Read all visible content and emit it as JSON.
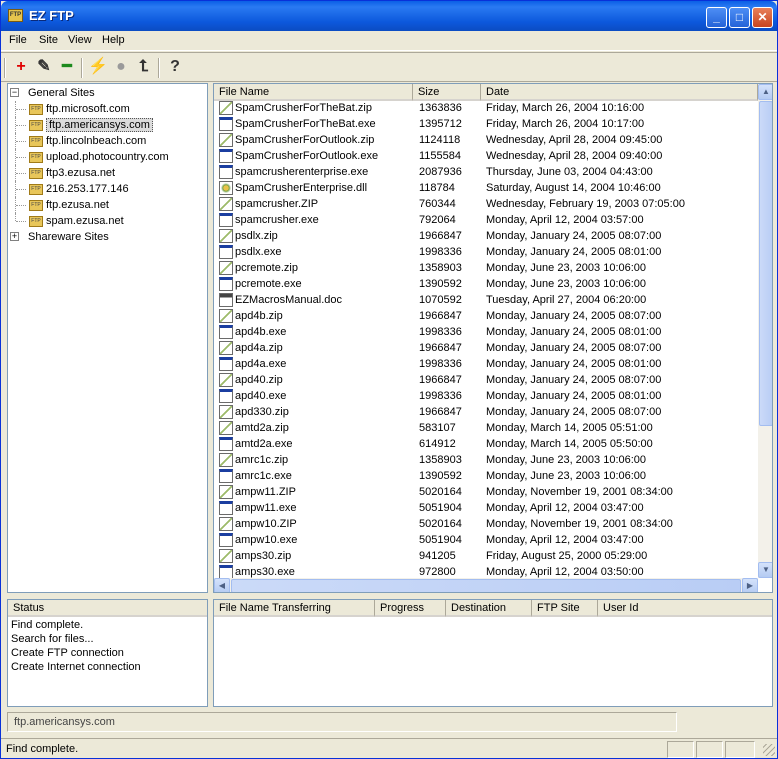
{
  "window": {
    "title": "EZ FTP",
    "app_icon_text": "FTP",
    "minimize": "_",
    "maximize": "□",
    "close": "✕"
  },
  "menu": [
    "File",
    "Site",
    "View",
    "Help"
  ],
  "toolbar": [
    {
      "name": "add-site-button",
      "glyph": "+",
      "color": "#e00000"
    },
    {
      "name": "edit-site-button",
      "glyph": "✎",
      "color": "#333333"
    },
    {
      "name": "remove-site-button",
      "glyph": "━",
      "color": "#1d8a1d"
    },
    {
      "name": "connect-button",
      "glyph": "⚡",
      "color": "#d9a400"
    },
    {
      "name": "disconnect-button",
      "glyph": "●",
      "color": "#9a9a9a"
    },
    {
      "name": "folder-up-button",
      "glyph": "⮤",
      "color": "#333333"
    },
    {
      "name": "help-button",
      "glyph": "?",
      "color": "#333333"
    }
  ],
  "tree": {
    "groups": [
      {
        "label": "General Sites",
        "expanded": true,
        "sites": [
          "ftp.microsoft.com",
          "ftp.americansys.com",
          "ftp.lincolnbeach.com",
          "upload.photocountry.com",
          "ftp3.ezusa.net",
          "216.253.177.146",
          "ftp.ezusa.net",
          "spam.ezusa.net"
        ],
        "selected": "ftp.americansys.com"
      },
      {
        "label": "Shareware Sites",
        "expanded": false,
        "sites": []
      }
    ],
    "folder_icon_text": "FTP",
    "expanded_symbol": "−",
    "collapsed_symbol": "+"
  },
  "files": {
    "columns": [
      "File Name",
      "Size",
      "Date"
    ],
    "rows": [
      {
        "name": "SpamCrusherForTheBat.zip",
        "size": "1363836",
        "date": "Friday, March 26, 2004 10:16:00",
        "type": "zip"
      },
      {
        "name": "SpamCrusherForTheBat.exe",
        "size": "1395712",
        "date": "Friday, March 26, 2004 10:17:00",
        "type": "exe"
      },
      {
        "name": "SpamCrusherForOutlook.zip",
        "size": "1124118",
        "date": "Wednesday, April 28, 2004 09:45:00",
        "type": "zip"
      },
      {
        "name": "SpamCrusherForOutlook.exe",
        "size": "1155584",
        "date": "Wednesday, April 28, 2004 09:40:00",
        "type": "exe"
      },
      {
        "name": "spamcrusherenterprise.exe",
        "size": "2087936",
        "date": "Thursday, June 03, 2004 04:43:00",
        "type": "exe"
      },
      {
        "name": "SpamCrusherEnterprise.dll",
        "size": "118784",
        "date": "Saturday, August 14, 2004 10:46:00",
        "type": "dll"
      },
      {
        "name": "spamcrusher.ZIP",
        "size": "760344",
        "date": "Wednesday, February 19, 2003 07:05:00",
        "type": "zip"
      },
      {
        "name": "spamcrusher.exe",
        "size": "792064",
        "date": "Monday, April 12, 2004 03:57:00",
        "type": "exe"
      },
      {
        "name": "psdlx.zip",
        "size": "1966847",
        "date": "Monday, January 24, 2005 08:07:00",
        "type": "zip"
      },
      {
        "name": "psdlx.exe",
        "size": "1998336",
        "date": "Monday, January 24, 2005 08:01:00",
        "type": "exe"
      },
      {
        "name": "pcremote.zip",
        "size": "1358903",
        "date": "Monday, June 23, 2003 10:06:00",
        "type": "zip"
      },
      {
        "name": "pcremote.exe",
        "size": "1390592",
        "date": "Monday, June 23, 2003 10:06:00",
        "type": "exe"
      },
      {
        "name": "EZMacrosManual.doc",
        "size": "1070592",
        "date": "Tuesday, April 27, 2004 06:20:00",
        "type": "doc"
      },
      {
        "name": "apd4b.zip",
        "size": "1966847",
        "date": "Monday, January 24, 2005 08:07:00",
        "type": "zip"
      },
      {
        "name": "apd4b.exe",
        "size": "1998336",
        "date": "Monday, January 24, 2005 08:01:00",
        "type": "exe"
      },
      {
        "name": "apd4a.zip",
        "size": "1966847",
        "date": "Monday, January 24, 2005 08:07:00",
        "type": "zip"
      },
      {
        "name": "apd4a.exe",
        "size": "1998336",
        "date": "Monday, January 24, 2005 08:01:00",
        "type": "exe"
      },
      {
        "name": "apd40.zip",
        "size": "1966847",
        "date": "Monday, January 24, 2005 08:07:00",
        "type": "zip"
      },
      {
        "name": "apd40.exe",
        "size": "1998336",
        "date": "Monday, January 24, 2005 08:01:00",
        "type": "exe"
      },
      {
        "name": "apd330.zip",
        "size": "1966847",
        "date": "Monday, January 24, 2005 08:07:00",
        "type": "zip"
      },
      {
        "name": "amtd2a.zip",
        "size": "583107",
        "date": "Monday, March 14, 2005 05:51:00",
        "type": "zip"
      },
      {
        "name": "amtd2a.exe",
        "size": "614912",
        "date": "Monday, March 14, 2005 05:50:00",
        "type": "exe"
      },
      {
        "name": "amrc1c.zip",
        "size": "1358903",
        "date": "Monday, June 23, 2003 10:06:00",
        "type": "zip"
      },
      {
        "name": "amrc1c.exe",
        "size": "1390592",
        "date": "Monday, June 23, 2003 10:06:00",
        "type": "exe"
      },
      {
        "name": "ampw11.ZIP",
        "size": "5020164",
        "date": "Monday, November 19, 2001 08:34:00",
        "type": "zip"
      },
      {
        "name": "ampw11.exe",
        "size": "5051904",
        "date": "Monday, April 12, 2004 03:47:00",
        "type": "exe"
      },
      {
        "name": "ampw10.ZIP",
        "size": "5020164",
        "date": "Monday, November 19, 2001 08:34:00",
        "type": "zip"
      },
      {
        "name": "ampw10.exe",
        "size": "5051904",
        "date": "Monday, April 12, 2004 03:47:00",
        "type": "exe"
      },
      {
        "name": "amps30.zip",
        "size": "941205",
        "date": "Friday, August 25, 2000 05:29:00",
        "type": "zip"
      },
      {
        "name": "amps30.exe",
        "size": "972800",
        "date": "Monday, April 12, 2004 03:50:00",
        "type": "exe"
      }
    ]
  },
  "status": {
    "header": "Status",
    "lines": [
      "Find complete.",
      "Search for files...",
      "Create FTP connection",
      "Create Internet connection"
    ]
  },
  "transfers": {
    "columns": [
      "File Name Transferring",
      "Progress",
      "Destination",
      "FTP Site",
      "User Id"
    ]
  },
  "address": "ftp.americansys.com",
  "statusbar": {
    "text": "Find complete."
  },
  "scroll": {
    "up": "▲",
    "down": "▼",
    "left": "◀",
    "right": "▶"
  },
  "colors": {
    "selection": "#dcdcdc",
    "title_blue": "#0a5fe6"
  }
}
